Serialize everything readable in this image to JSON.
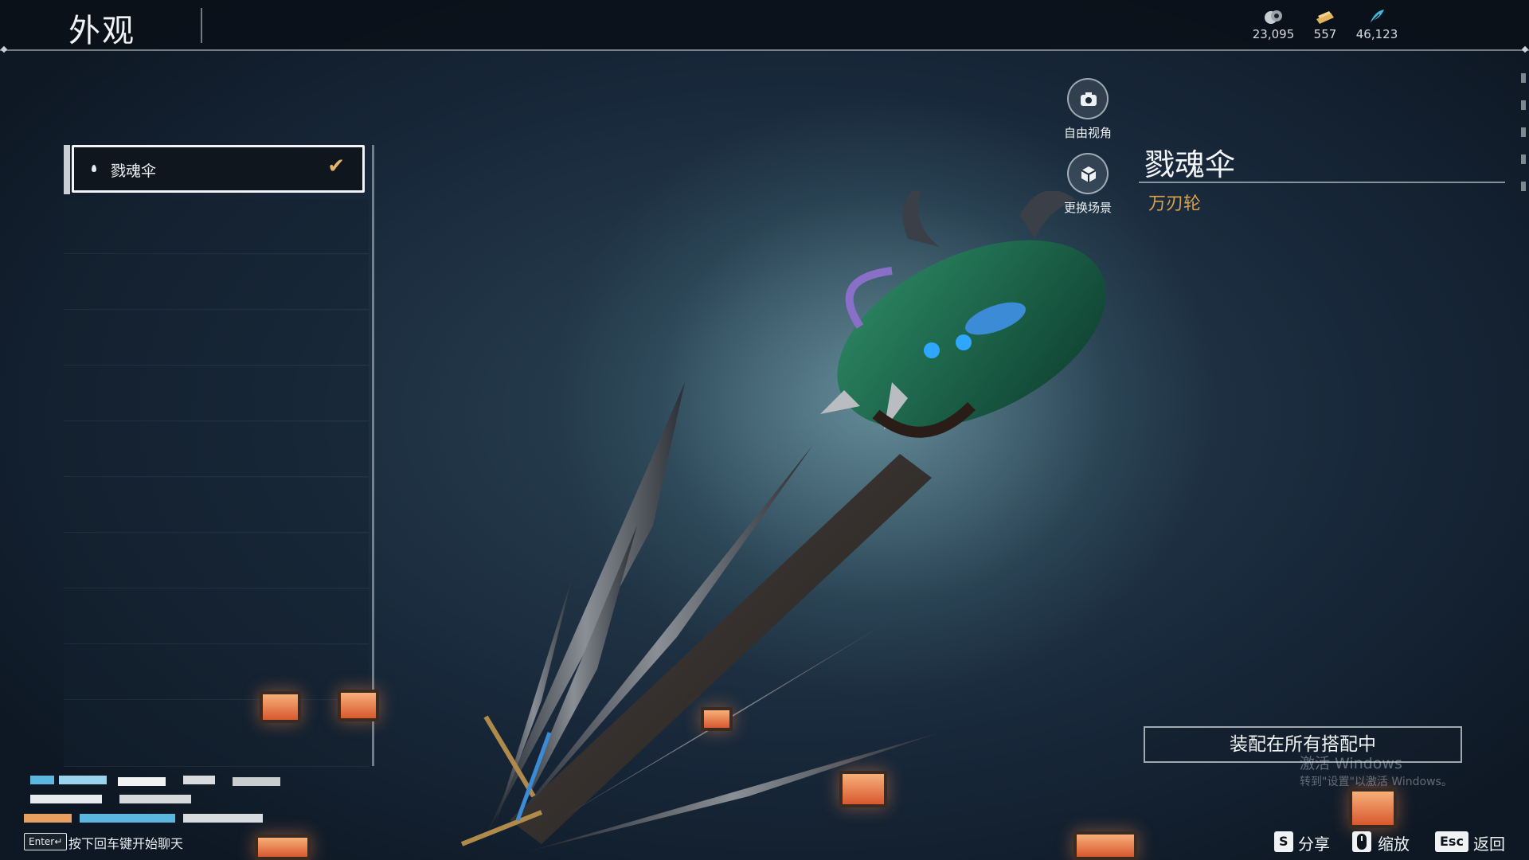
{
  "header": {
    "title": "外观"
  },
  "currencies": [
    {
      "icon": "coin-icon",
      "value": "23,095",
      "color": "#c8cfd3"
    },
    {
      "icon": "ticket-icon",
      "value": "557",
      "color": "#e3b45c"
    },
    {
      "icon": "feather-icon",
      "value": "46,123",
      "color": "#42b6d8"
    }
  ],
  "list": {
    "items": [
      {
        "label": "戮魂伞",
        "selected": true,
        "check_icon": "checkmark-icon"
      }
    ]
  },
  "preview": {
    "free_view_label": "自由视角",
    "change_scene_label": "更换场景",
    "item_name": "戮魂伞",
    "item_type": "万刃轮",
    "accent_color": "#d9a24a"
  },
  "equip": {
    "button_label": "装配在所有搭配中"
  },
  "watermark": {
    "line1": "激活 Windows",
    "line2": "转到\"设置\"以激活 Windows。"
  },
  "chat": {
    "enter_key": "Enter↵",
    "hint": "按下回车键开始聊天"
  },
  "footer": [
    {
      "key": "S",
      "label": "分享"
    },
    {
      "key_icon": "mouse-icon",
      "label": "缩放"
    },
    {
      "key": "Esc",
      "label": "返回"
    }
  ]
}
